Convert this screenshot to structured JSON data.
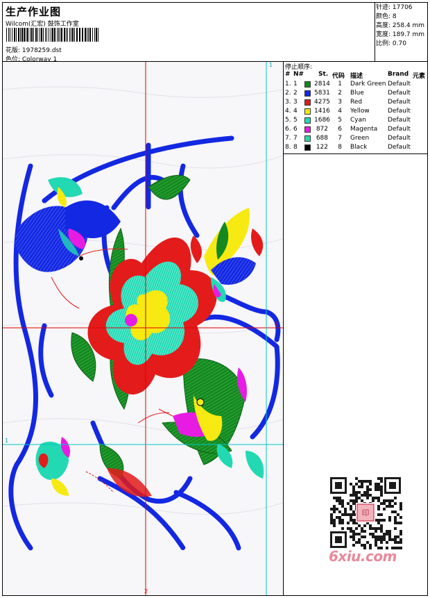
{
  "header": {
    "title": "生产作业图",
    "company": "Wilcom(汇宏) 鼓饰工作室",
    "pattern": "花版: 1978259.dst",
    "colorway": "色位: Colorway 1"
  },
  "stats": {
    "stitches": "针迹: 17706",
    "colors": "颜色: 8",
    "height": "高度: 258.4 mm",
    "width": "宽度: 189.7 mm",
    "scale": "比例: 0.70"
  },
  "stop_sequence": {
    "title": "停止顺序:",
    "headers": [
      "#",
      "N#",
      "St.",
      "代码",
      "描述",
      "Brand",
      "元素"
    ],
    "rows": [
      {
        "idx": "1.",
        "n": "1",
        "color": "#13891f",
        "st": "2814",
        "code": "1",
        "desc": "Dark Green",
        "brand": "Default"
      },
      {
        "idx": "2.",
        "n": "2",
        "color": "#1328e2",
        "st": "5831",
        "code": "2",
        "desc": "Blue",
        "brand": "Default"
      },
      {
        "idx": "3.",
        "n": "3",
        "color": "#e41b1b",
        "st": "4275",
        "code": "3",
        "desc": "Red",
        "brand": "Default"
      },
      {
        "idx": "4.",
        "n": "4",
        "color": "#f6ea12",
        "st": "1416",
        "code": "4",
        "desc": "Yellow",
        "brand": "Default"
      },
      {
        "idx": "5.",
        "n": "5",
        "color": "#22d9b4",
        "st": "1686",
        "code": "5",
        "desc": "Cyan",
        "brand": "Default"
      },
      {
        "idx": "6.",
        "n": "6",
        "color": "#e71ce3",
        "st": "872",
        "code": "6",
        "desc": "Magenta",
        "brand": "Default"
      },
      {
        "idx": "7.",
        "n": "7",
        "color": "#2bd7a8",
        "st": "688",
        "code": "7",
        "desc": "Green",
        "brand": "Default"
      },
      {
        "idx": "8.",
        "n": "8",
        "color": "#000000",
        "st": "122",
        "code": "8",
        "desc": "Black",
        "brand": "Default"
      }
    ]
  },
  "guides": {
    "top_right": "1",
    "right_mid": "2",
    "left_low": "1",
    "bottom": "2"
  },
  "watermark": {
    "site": "6xiu.com",
    "stamp": "印"
  }
}
